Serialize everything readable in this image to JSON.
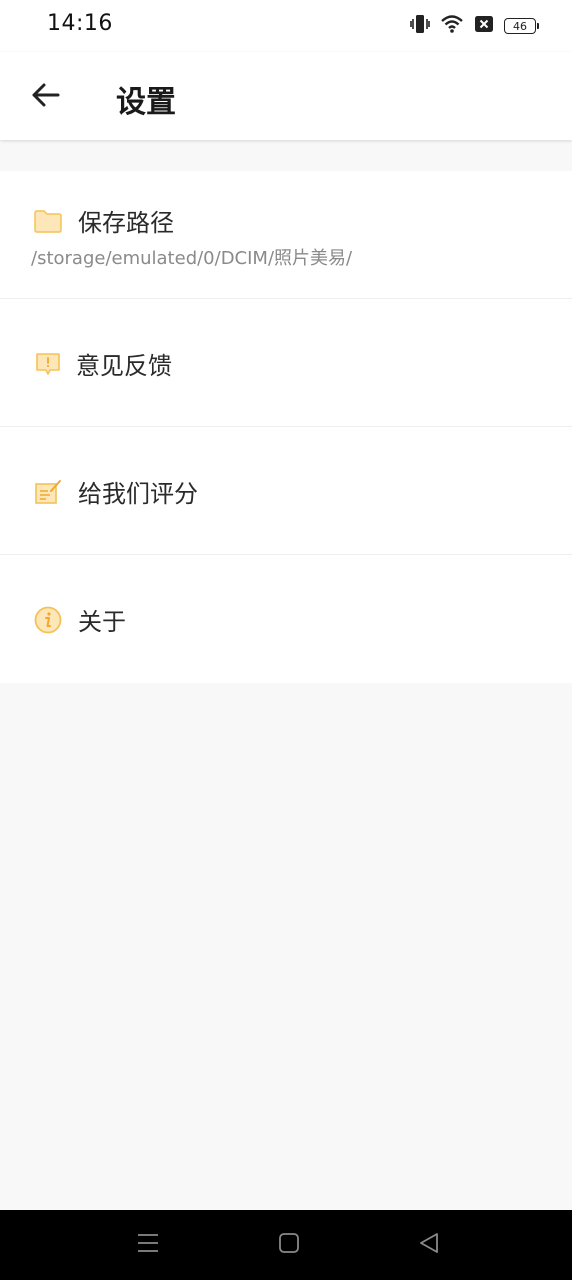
{
  "status_bar": {
    "time": "14:16",
    "battery_level": "46",
    "icons": [
      "vibrate-icon",
      "wifi-icon",
      "sim-blocked-icon",
      "battery-icon"
    ]
  },
  "app_bar": {
    "back_icon": "arrow-left-icon",
    "title": "设置"
  },
  "settings": {
    "items": [
      {
        "icon": "folder-icon",
        "label": "保存路径",
        "subtitle": "/storage/emulated/0/DCIM/照片美易/"
      },
      {
        "icon": "feedback-icon",
        "label": "意见反馈"
      },
      {
        "icon": "rate-icon",
        "label": "给我们评分"
      },
      {
        "icon": "info-icon",
        "label": "关于"
      }
    ]
  },
  "nav_bar": {
    "buttons": [
      "menu-icon",
      "home-icon",
      "back-triangle-icon"
    ]
  },
  "colors": {
    "icon_accent": "#f5c257",
    "icon_fill": "#fde6b8",
    "background": "#f8f8f8"
  }
}
